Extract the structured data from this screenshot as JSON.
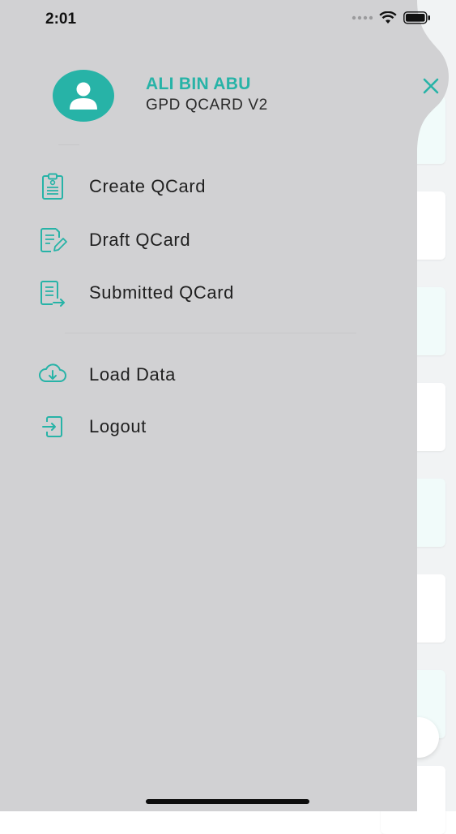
{
  "status_bar": {
    "time": "2:01"
  },
  "profile": {
    "name": "ALI BIN ABU",
    "app_name": "GPD QCARD V2"
  },
  "menu": {
    "items": [
      {
        "label": "Create QCard",
        "icon": "clipboard-icon"
      },
      {
        "label": "Draft QCard",
        "icon": "edit-document-icon"
      },
      {
        "label": "Submitted QCard",
        "icon": "submitted-document-icon"
      }
    ],
    "secondary": [
      {
        "label": "Load Data",
        "icon": "cloud-download-icon"
      },
      {
        "label": "Logout",
        "icon": "logout-icon"
      }
    ]
  },
  "colors": {
    "accent": "#27b3a7",
    "drawer_bg": "#d1d1d3",
    "text": "#1f1f1f"
  }
}
